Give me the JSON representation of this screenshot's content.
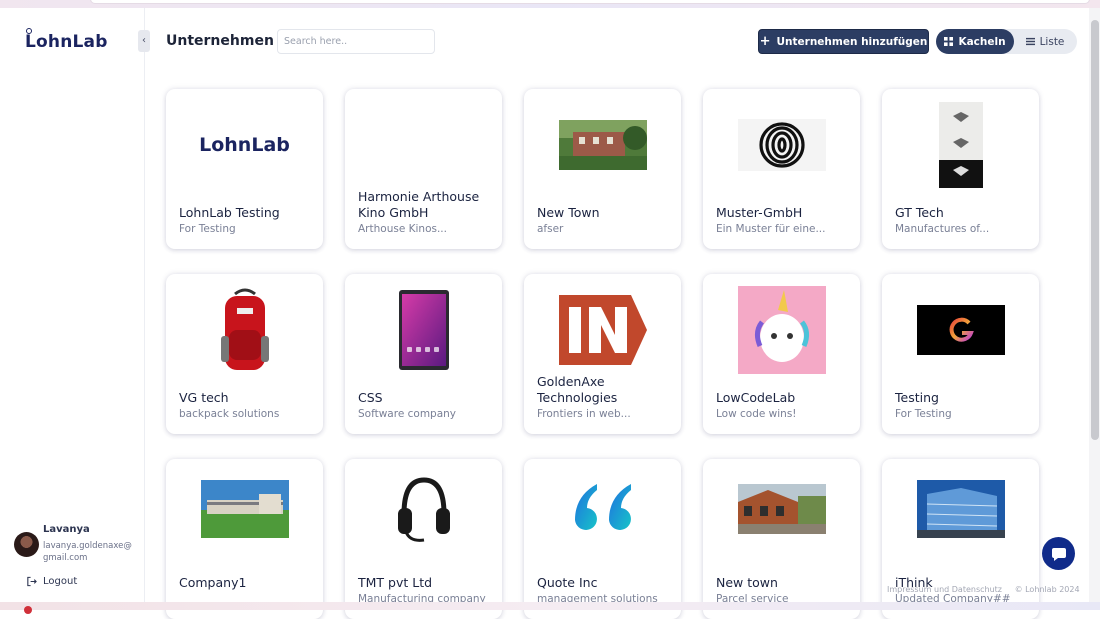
{
  "app": {
    "logo": "LohnLab"
  },
  "header": {
    "title": "Unternehmen",
    "search_placeholder": "Search here..",
    "add_button": "Unternehmen hinzufügen",
    "view_tiles": "Kacheln",
    "view_list": "Liste"
  },
  "user": {
    "name": "Lavanya",
    "email": "lavanya.goldenaxe@gmail.com",
    "logout": "Logout"
  },
  "companies": [
    {
      "name": "LohnLab Testing",
      "desc": "For Testing",
      "thumb": "lohnlab-logo"
    },
    {
      "name": "Harmonie Arthouse Kino GmbH",
      "desc": "Arthouse Kinos...",
      "thumb": "none"
    },
    {
      "name": "New Town",
      "desc": "afser",
      "thumb": "house-photo"
    },
    {
      "name": "Muster-GmbH",
      "desc": "Ein Muster für eine...",
      "thumb": "swirl-logo"
    },
    {
      "name": "GT Tech",
      "desc": "Manufactures of...",
      "thumb": "gt-logo"
    },
    {
      "name": "VG tech",
      "desc": "backpack solutions",
      "thumb": "backpack"
    },
    {
      "name": "CSS",
      "desc": "Software company",
      "thumb": "tablet"
    },
    {
      "name": "GoldenAxe Technologies",
      "desc": "Frontiers in web...",
      "thumb": "in-logo"
    },
    {
      "name": "LowCodeLab",
      "desc": "Low code wins!",
      "thumb": "unicorn"
    },
    {
      "name": "Testing",
      "desc": "For Testing",
      "thumb": "g-logo"
    },
    {
      "name": "Company1",
      "desc": "",
      "thumb": "building-photo"
    },
    {
      "name": "TMT pvt Ltd",
      "desc": "Manufacturing company",
      "thumb": "headset"
    },
    {
      "name": "Quote Inc",
      "desc": "management solutions",
      "thumb": "quote-logo"
    },
    {
      "name": "New town",
      "desc": "Parcel service",
      "thumb": "house2-photo"
    },
    {
      "name": "iThink",
      "desc": "Updated Company##",
      "thumb": "office-photo"
    }
  ],
  "thumb_text": {
    "lohnlab": "LohnLab"
  },
  "footer": {
    "links": "Impressum und Datenschutz",
    "copyright": "© Lohnlab 2024"
  },
  "colors": {
    "primary": "#2c3d63",
    "brand": "#1b2460",
    "chat": "#102b8a"
  }
}
